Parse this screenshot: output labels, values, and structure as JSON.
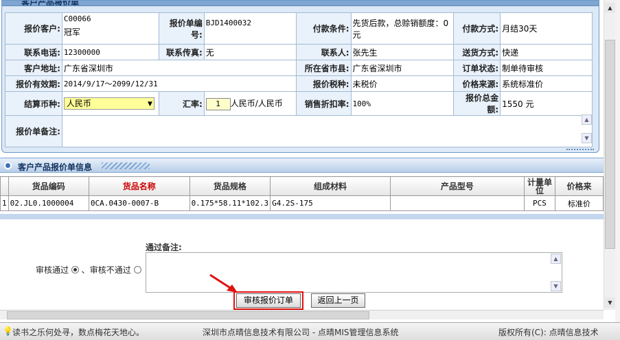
{
  "panel": {
    "title": "客户产品报价单"
  },
  "form": {
    "customer_label": "报价客户:",
    "customer_code": "C00066",
    "customer_name": "冠军",
    "quote_no_label": "报价单编号:",
    "quote_no": "BJD1400032",
    "pay_terms_label": "付款条件:",
    "pay_terms": "先货后款，总赊销额度：0元",
    "pay_method_label": "付款方式:",
    "pay_method": "月结30天",
    "phone_label": "联系电话:",
    "phone": "12300000",
    "fax_label": "联系传真:",
    "fax": "无",
    "contact_label": "联系人:",
    "contact": "张先生",
    "delivery_label": "送货方式:",
    "delivery": "快递",
    "address_label": "客户地址:",
    "address": "广东省深圳市",
    "region_label": "所在省市县:",
    "region": "广东省深圳市",
    "status_label": "订单状态:",
    "status": "制单待审核",
    "valid_label": "报价有效期:",
    "valid": "2014/9/17～2099/12/31",
    "tax_label": "报价税种:",
    "tax": "未税价",
    "price_src_label": "价格来源:",
    "price_src": "系统标准价",
    "currency_label": "结算币种:",
    "currency": "人民币",
    "rate_label": "汇率:",
    "rate": "1",
    "rate_unit": "人民币/人民币",
    "discount_label": "销售折扣率:",
    "discount": "100%",
    "total_label": "报价总金额:",
    "total": "1550 元",
    "remark_label": "报价单备注:"
  },
  "section2": {
    "title": "客户产品报价单信息"
  },
  "grid": {
    "headers": [
      "货品编码",
      "货品名称",
      "货品规格",
      "组成材料",
      "产品型号",
      "计量单位",
      "价格来"
    ],
    "row": {
      "idx": "1",
      "code": "02.JL0.1000004",
      "name": "0CA.0430-0007-B",
      "spec": "0.175*58.11*102.3",
      "material": "G4.2S-175",
      "model": "",
      "unit": "PCS",
      "price": "标准价"
    }
  },
  "audit": {
    "pass_label": "审核通过",
    "sep": "、",
    "fail_label": "审核不通过",
    "note_label": "通过备注:"
  },
  "buttons": {
    "approve": "审核报价订单",
    "back": "返回上一页"
  },
  "statusbar": {
    "quote": "读书之乐何处寻，数点梅花天地心。",
    "company": "深圳市点晴信息技术有限公司 - 点晴MIS管理信息系统",
    "copyright": "版权所有(C): 点晴信息技术"
  },
  "colors": {
    "accent": "#3c6fb4",
    "highlight": "#e01010",
    "title_red": "#cc0000"
  }
}
